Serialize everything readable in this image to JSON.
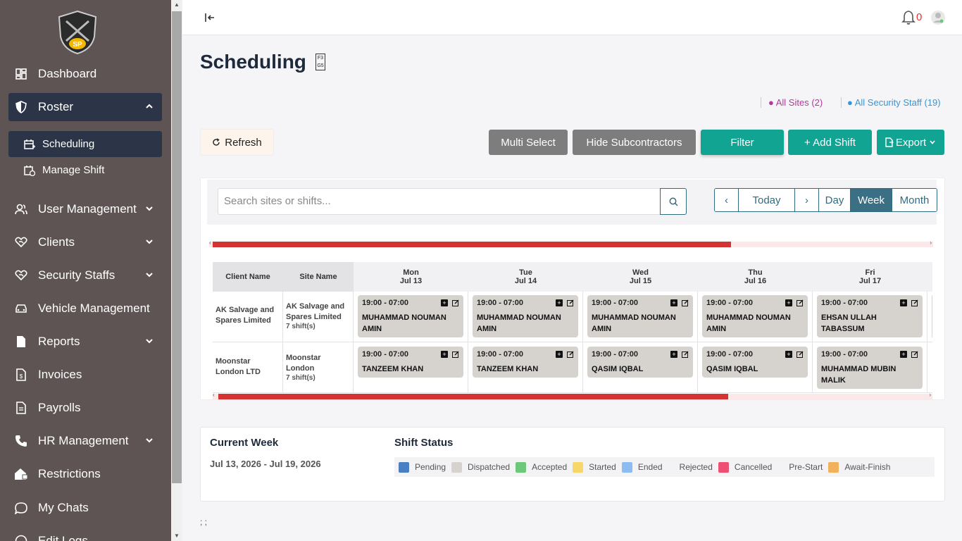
{
  "sidebar": {
    "logo_text": "SP",
    "items": [
      {
        "label": "Dashboard"
      },
      {
        "label": "Roster"
      },
      {
        "label": "User Management"
      },
      {
        "label": "Clients"
      },
      {
        "label": "Security Staffs"
      },
      {
        "label": "Vehicle Management"
      },
      {
        "label": "Reports"
      },
      {
        "label": "Invoices"
      },
      {
        "label": "Payrolls"
      },
      {
        "label": "HR Management"
      },
      {
        "label": "Restrictions"
      },
      {
        "label": "My Chats"
      },
      {
        "label": "Edit Logs"
      }
    ],
    "subitems": [
      {
        "label": "Scheduling"
      },
      {
        "label": "Manage Shift"
      }
    ]
  },
  "topbar": {
    "notification_count": "0"
  },
  "page": {
    "title": "Scheduling",
    "title_icon_text": "F3 G5",
    "all_sites": "● All Sites (2)",
    "all_staff": "● All Security Staff (19)"
  },
  "toolbar": {
    "refresh": "Refresh",
    "multi_select": "Multi Select",
    "hide_sub": "Hide Subcontractors",
    "filter": "Filter",
    "add_shift": "+ Add Shift",
    "export": "Export"
  },
  "search": {
    "placeholder": "Search sites or shifts..."
  },
  "views": {
    "prev": "‹",
    "today": "Today",
    "next": "›",
    "day": "Day",
    "week": "Week",
    "month": "Month"
  },
  "grid": {
    "col_client": "Client Name",
    "col_site": "Site Name",
    "days": [
      {
        "dow": "Mon",
        "date": "Jul 13"
      },
      {
        "dow": "Tue",
        "date": "Jul 14"
      },
      {
        "dow": "Wed",
        "date": "Jul 15"
      },
      {
        "dow": "Thu",
        "date": "Jul 16"
      },
      {
        "dow": "Fri",
        "date": "Jul 17"
      }
    ],
    "rows": [
      {
        "client": "AK Salvage and Spares Limited",
        "site": "AK Salvage and Spares Limited",
        "shift_count": "7 shift(s)",
        "shifts": [
          {
            "time": "19:00 - 07:00",
            "name": "MUHAMMAD NOUMAN AMIN"
          },
          {
            "time": "19:00 - 07:00",
            "name": "MUHAMMAD NOUMAN AMIN"
          },
          {
            "time": "19:00 - 07:00",
            "name": "MUHAMMAD NOUMAN AMIN"
          },
          {
            "time": "19:00 - 07:00",
            "name": "MUHAMMAD NOUMAN AMIN"
          },
          {
            "time": "19:00 - 07:00",
            "name": "EHSAN ULLAH TABASSUM"
          }
        ]
      },
      {
        "client": "Moonstar London LTD",
        "site": "Moonstar London",
        "shift_count": "7 shift(s)",
        "shifts": [
          {
            "time": "19:00 - 07:00",
            "name": "TANZEEM KHAN"
          },
          {
            "time": "19:00 - 07:00",
            "name": "TANZEEM KHAN"
          },
          {
            "time": "19:00 - 07:00",
            "name": "QASIM IQBAL"
          },
          {
            "time": "19:00 - 07:00",
            "name": "QASIM IQBAL"
          },
          {
            "time": "19:00 - 07:00",
            "name": "MUHAMMAD MUBIN MALIK"
          }
        ]
      }
    ]
  },
  "summary": {
    "current_week_title": "Current Week",
    "date_range": "Jul 13, 2026 - Jul 19, 2026",
    "status_title": "Shift Status",
    "legend": [
      {
        "label": "Pending",
        "color": "#4a7fc1"
      },
      {
        "label": "Dispatched",
        "color": "#d6d3cf"
      },
      {
        "label": "Accepted",
        "color": "#6cc97a"
      },
      {
        "label": "Started",
        "color": "#f7d66a"
      },
      {
        "label": "Ended",
        "color": "#8cbcf2"
      },
      {
        "label": "Rejected",
        "color": ""
      },
      {
        "label": "Cancelled",
        "color": "#ee4f72"
      },
      {
        "label": "Pre-Start",
        "color": ""
      },
      {
        "label": "Await-Finish",
        "color": "#f2b25c"
      }
    ]
  },
  "footer": {
    "text": "; ;"
  }
}
